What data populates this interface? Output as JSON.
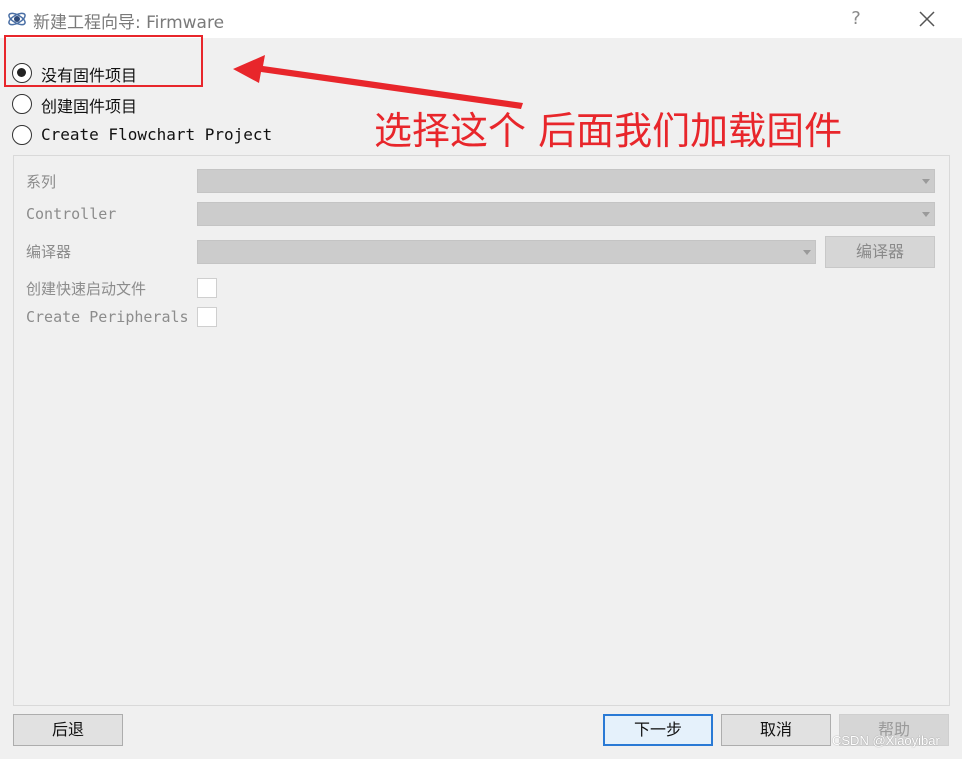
{
  "window": {
    "title": "新建工程向导: Firmware",
    "help_label": "?",
    "app_icon": "qt-creator-icon",
    "close_icon": "close-icon"
  },
  "project_types": [
    {
      "label": "没有固件项目",
      "checked": true
    },
    {
      "label": "创建固件项目",
      "checked": false
    },
    {
      "label": "Create Flowchart Project",
      "checked": false
    }
  ],
  "form": {
    "series_label": "系列",
    "controller_label": "Controller",
    "compiler_label": "编译器",
    "compiler_button": "编译器",
    "quickstart_label": "创建快速启动文件",
    "peripherals_label": "Create Peripherals"
  },
  "buttons": {
    "back": "后退",
    "next": "下一步",
    "cancel": "取消",
    "help": "帮助"
  },
  "annotation": {
    "text": "选择这个 后面我们加载固件",
    "color": "#e8262b"
  },
  "watermark": "CSDN @Xiaoyibar"
}
